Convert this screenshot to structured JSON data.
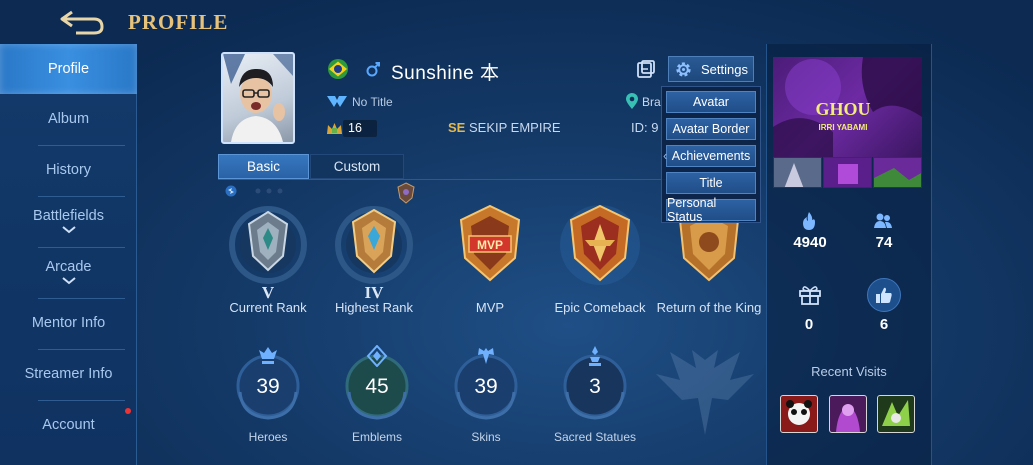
{
  "header": {
    "title": "PROFILE"
  },
  "sidebar": {
    "items": [
      {
        "label": "Profile"
      },
      {
        "label": "Album"
      },
      {
        "label": "History"
      },
      {
        "label": "Battlefields"
      },
      {
        "label": "Arcade"
      },
      {
        "label": "Mentor Info"
      },
      {
        "label": "Streamer Info"
      },
      {
        "label": "Account"
      }
    ]
  },
  "profile": {
    "name": "Sunshine 本",
    "title": "No Title",
    "level": "16",
    "squad_tag": "SE",
    "squad_name": "SEKIP EMPIRE",
    "location": "Bra",
    "id_label": "ID: 9"
  },
  "settings": {
    "label": "Settings",
    "menu": [
      "Avatar",
      "Avatar Border",
      "Achievements",
      "Title",
      "Personal Status"
    ]
  },
  "tabs": [
    {
      "label": "Basic"
    },
    {
      "label": "Custom"
    }
  ],
  "achievements": [
    {
      "label": "Current Rank",
      "numeral": "V"
    },
    {
      "label": "Highest Rank",
      "numeral": "IV"
    },
    {
      "label": "MVP",
      "badge": "MVP"
    },
    {
      "label": "Epic Comeback"
    },
    {
      "label": "Return of the King"
    }
  ],
  "stats": [
    {
      "label": "Heroes",
      "value": "39"
    },
    {
      "label": "Emblems",
      "value": "45"
    },
    {
      "label": "Skins",
      "value": "39"
    },
    {
      "label": "Sacred Statues",
      "value": "3"
    }
  ],
  "right_panel": {
    "banner_text": "GHOU",
    "banner_sub": "IRRI YABAMI",
    "popularity": "4940",
    "friends": "74",
    "gifts": "0",
    "likes": "6",
    "recent_visits_title": "Recent Visits"
  },
  "colors": {
    "accent_gold": "#e6c27a",
    "active_tab": "#3677bf",
    "background": "#0e2f5a"
  }
}
